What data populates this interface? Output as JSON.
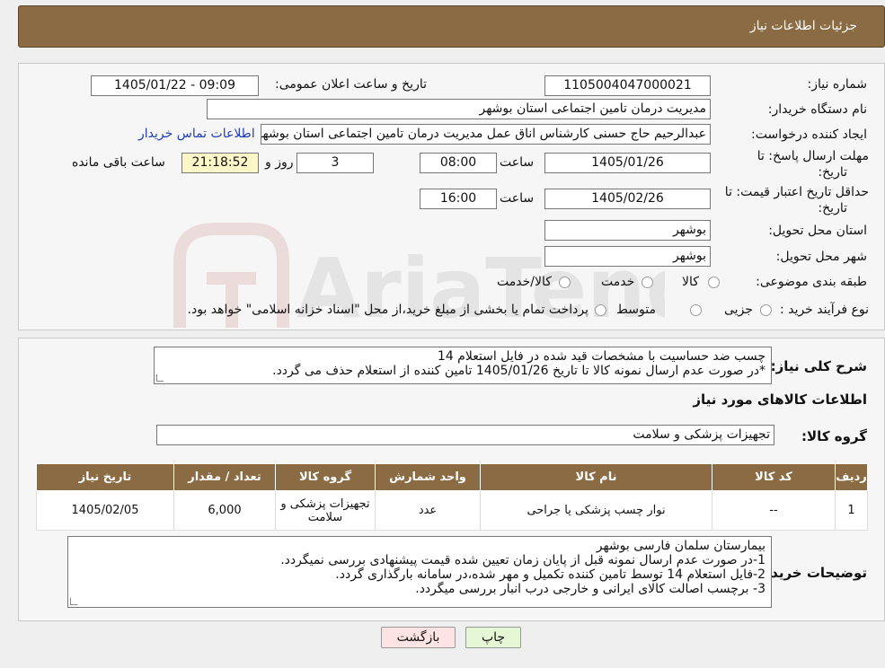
{
  "header": {
    "title": "جزئیات اطلاعات نیاز"
  },
  "form": {
    "need_number_label": "شماره نیاز:",
    "need_number": "1105004047000021",
    "announce_label": "تاریخ و ساعت اعلان عمومی:",
    "announce_value": "1405/01/22 - 09:09",
    "buyer_org_label": "نام دستگاه خریدار:",
    "buyer_org": "مدیریت درمان تامین اجتماعی استان بوشهر",
    "creator_label": "ایجاد کننده درخواست:",
    "creator": "عبدالرحیم حاج حسنی کارشناس اناق عمل مدیریت درمان تامین اجتماعی استان بوشهر",
    "contact_link": "اطلاعات تماس خریدار",
    "deadline_label_1": "مهلت ارسال پاسخ: تا",
    "deadline_label_2": "تاریخ:",
    "deadline_date": "1405/01/26",
    "time_label": "ساعت",
    "deadline_time": "08:00",
    "days_value": "3",
    "days_label": "روز و",
    "remaining_time": "21:18:52",
    "remaining_label": "ساعت باقی مانده",
    "validity_label_1": "حداقل تاریخ اعتبار قیمت: تا",
    "validity_label_2": "تاریخ:",
    "validity_date": "1405/02/26",
    "validity_time": "16:00",
    "province_label": "استان محل تحویل:",
    "province": "بوشهر",
    "city_label": "شهر محل تحویل:",
    "city": "بوشهر",
    "category_label": "طبقه بندی موضوعی:",
    "category_options": [
      "کالا",
      "خدمت",
      "کالا/خدمت"
    ],
    "process_label": "نوع فرآیند خرید :",
    "process_options": [
      "جزیی",
      "متوسط"
    ],
    "process_note": "پرداخت تمام یا بخشی از مبلغ خرید،از محل \"اسناد خزانه اسلامی\" خواهد بود."
  },
  "summary": {
    "label": "شرح کلی نیاز:",
    "line1": "چسب ضد حساسیت با مشخصات قید شده در فایل استعلام 14",
    "line2": "*در صورت عدم ارسال نمونه کالا تا تاریخ 1405/01/26 تامین کننده از استعلام حذف می گردد."
  },
  "goods": {
    "section_title": "اطلاعات کالاهای مورد نیاز",
    "group_label": "گروه کالا:",
    "group_value": "تجهیزات پزشکی و سلامت"
  },
  "table": {
    "headers": [
      "ردیف",
      "کد کالا",
      "نام کالا",
      "واحد شمارش",
      "گروه کالا",
      "تعداد / مقدار",
      "تاریخ نیاز"
    ],
    "rows": [
      [
        "1",
        "--",
        "نوار چسب پزشکی یا جراحی",
        "عدد",
        "تجهیزات پزشکی و سلامت",
        "6,000",
        "1405/02/05"
      ]
    ]
  },
  "buyer_notes": {
    "label": "توضیحات خریدار:",
    "line1": "بیمارستان سلمان فارسی بوشهر",
    "line2": "1-در صورت عدم ارسال نمونه قبل از پایان زمان تعیین شده قیمت پیشنهادی بررسی نمیگردد.",
    "line3": "2-فایل استعلام 14 توسط تامین کننده تکمیل و مهر شده،در سامانه بارگذاری گردد.",
    "line4": "3- برچسب اصالت کالای ایرانی و خارجی درب انبار بررسی میگردد."
  },
  "buttons": {
    "print": "چاپ",
    "back": "بازگشت"
  },
  "watermark": {
    "text": "AriaTender.neT"
  },
  "colors": {
    "header": "#8b6b44",
    "link": "#1f3dbb",
    "back_button": "#fde3e3",
    "print_button": "#e6f7d6",
    "remaining_box": "#fff7c8"
  }
}
